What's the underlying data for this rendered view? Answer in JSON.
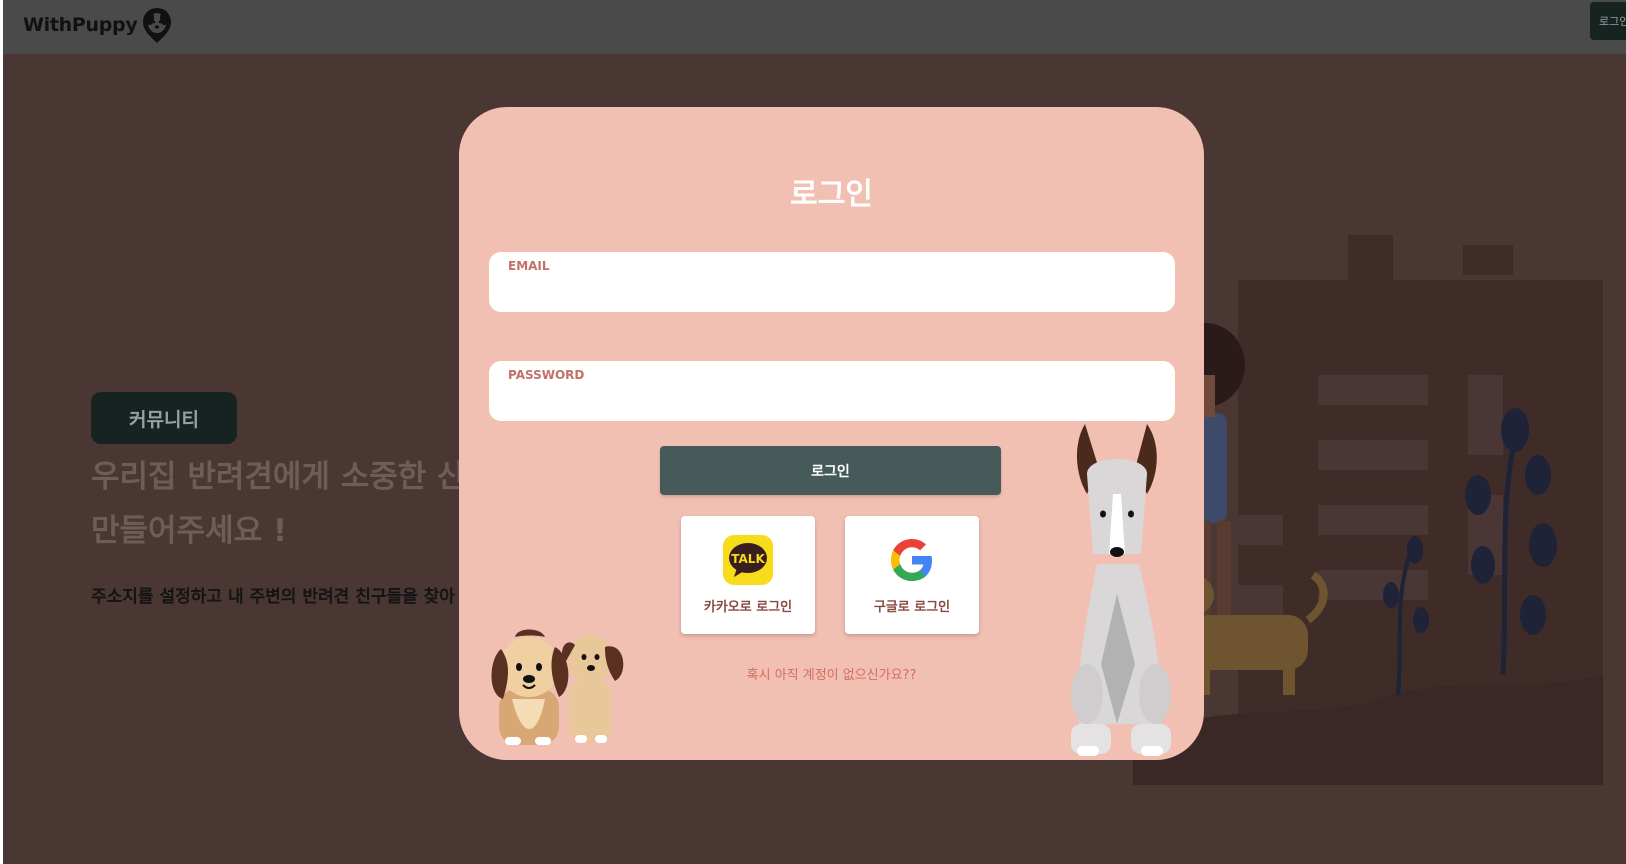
{
  "header": {
    "logo_text": "WithPuppy",
    "logo_icon": "dog-face-pin-icon",
    "login_button": "로그인"
  },
  "hero": {
    "category_button": "커뮤니티",
    "title_line1": "우리집 반려견에게 소중한 산",
    "title_line2": "만들어주세요 !",
    "subtitle": "주소지를 설정하고 내 주변의 반려견 친구들을 찾아"
  },
  "modal": {
    "title": "로그인",
    "email_label": "EMAIL",
    "email_value": "",
    "password_label": "PASSWORD",
    "password_value": "",
    "submit_label": "로그인",
    "kakao": {
      "label": "카카오로 로그인",
      "icon_text": "TALK",
      "icon": "kakao-talk-icon"
    },
    "google": {
      "label": "구글로 로그인",
      "icon": "google-g-icon"
    },
    "signup_link": "혹시 아직 계정이 없으신가요??"
  },
  "colors": {
    "page_bg": "#4a3633",
    "topbar_bg": "#4a4a4a",
    "modal_bg": "#f2c0b2",
    "primary_button": "#465a5a",
    "dark_button": "#172321",
    "accent_text": "#c2706a"
  }
}
